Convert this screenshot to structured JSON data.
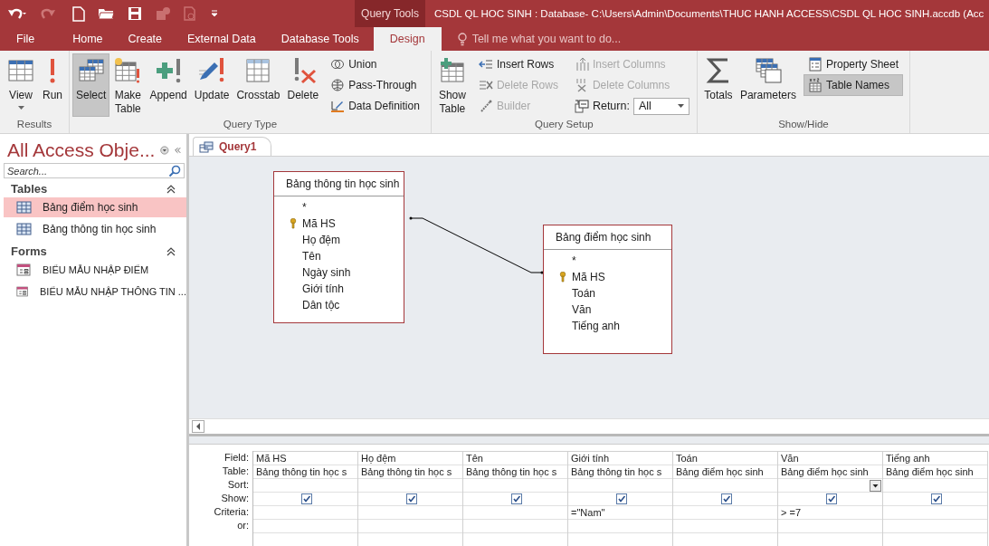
{
  "context_tab": "Query Tools",
  "window": {
    "title": "CSDL QL HOC SINH : Database- C:\\Users\\Admin\\Documents\\THUC HANH ACCESS\\CSDL QL HOC SINH.accdb (Acc"
  },
  "tabs": [
    {
      "label": "File",
      "selected": false
    },
    {
      "label": "Home",
      "selected": false
    },
    {
      "label": "Create",
      "selected": false
    },
    {
      "label": "External Data",
      "selected": false
    },
    {
      "label": "Database Tools",
      "selected": false
    },
    {
      "label": "Design",
      "selected": true
    }
  ],
  "tell_me": {
    "placeholder": "Tell me what you want to do..."
  },
  "ribbon": {
    "groups": [
      {
        "label": "Results",
        "large": [
          {
            "label": "View",
            "selected": false,
            "disabled": false,
            "has_menu": true
          },
          {
            "label": "Run",
            "selected": false,
            "disabled": false
          }
        ]
      },
      {
        "label": "Query Type",
        "large": [
          {
            "label": "Select",
            "selected": true,
            "disabled": false
          },
          {
            "label": "Make Table",
            "selected": false,
            "disabled": false
          },
          {
            "label": "Append",
            "selected": false,
            "disabled": false
          },
          {
            "label": "Update",
            "selected": false,
            "disabled": false
          },
          {
            "label": "Crosstab",
            "selected": false,
            "disabled": false
          },
          {
            "label": "Delete",
            "selected": false,
            "disabled": false
          }
        ],
        "small_columns": [
          [
            {
              "kind": "small",
              "label": "Union",
              "selected": false,
              "disabled": false
            },
            {
              "kind": "small",
              "label": "Pass-Through",
              "selected": false,
              "disabled": false
            },
            {
              "kind": "small",
              "label": "Data Definition",
              "selected": false,
              "disabled": false
            }
          ]
        ]
      },
      {
        "label": "Query Setup",
        "large": [
          {
            "label": "Show Table",
            "selected": false,
            "disabled": false
          }
        ],
        "small_columns": [
          [
            {
              "kind": "small",
              "label": "Insert Rows",
              "selected": false,
              "disabled": false
            },
            {
              "kind": "small",
              "label": "Delete Rows",
              "selected": false,
              "disabled": true
            },
            {
              "kind": "small",
              "label": "Builder",
              "selected": false,
              "disabled": true
            }
          ],
          [
            {
              "kind": "small",
              "label": "Insert Columns",
              "selected": false,
              "disabled": true
            },
            {
              "kind": "small",
              "label": "Delete Columns",
              "selected": false,
              "disabled": true
            },
            {
              "kind": "dropdown",
              "label": "Return:",
              "value": "All",
              "disabled": false
            }
          ]
        ]
      },
      {
        "label": "Show/Hide",
        "large": [
          {
            "label": "Totals",
            "selected": false,
            "disabled": false
          },
          {
            "label": "Parameters",
            "selected": false,
            "disabled": false
          }
        ],
        "small_columns": [
          [
            {
              "kind": "small",
              "label": "Property Sheet",
              "selected": false,
              "disabled": false
            },
            {
              "kind": "small",
              "label": "Table Names",
              "selected": true,
              "disabled": false
            }
          ]
        ]
      }
    ]
  },
  "navigation": {
    "title": "All Access Obje...",
    "search": {
      "placeholder": "Search..."
    },
    "groups": [
      {
        "label": "Tables",
        "kind": "tables",
        "items": [
          {
            "label": "Bảng điểm học sinh",
            "selected": true
          },
          {
            "label": "Bảng thông tin học sinh",
            "selected": false
          }
        ]
      },
      {
        "label": "Forms",
        "kind": "forms",
        "items": [
          {
            "label": "BIỂU MẪU NHẬP ĐIỂM",
            "selected": false
          },
          {
            "label": "BIỂU MẪU NHẬP THÔNG TIN ...",
            "selected": false
          }
        ]
      }
    ]
  },
  "document_tabs": [
    {
      "label": "Query1",
      "selected": true
    }
  ],
  "tables": [
    {
      "title": "Bảng thông tin học sinh",
      "fields": [
        {
          "name": "*",
          "key": false
        },
        {
          "name": "Mã HS",
          "key": true
        },
        {
          "name": "Họ đệm",
          "key": false
        },
        {
          "name": "Tên",
          "key": false
        },
        {
          "name": "Ngày sinh",
          "key": false
        },
        {
          "name": "Giới tính",
          "key": false
        },
        {
          "name": "Dân tộc",
          "key": false
        }
      ]
    },
    {
      "title": "Bảng điểm học sinh",
      "fields": [
        {
          "name": "*",
          "key": false
        },
        {
          "name": "Mã HS",
          "key": true
        },
        {
          "name": "Toán",
          "key": false
        },
        {
          "name": "Văn",
          "key": false
        },
        {
          "name": "Tiếng anh",
          "key": false
        }
      ]
    }
  ],
  "design_grid": {
    "row_labels": [
      "Field:",
      "Table:",
      "Sort:",
      "Show:",
      "Criteria:",
      "or:"
    ],
    "columns": [
      {
        "field": "Mã HS",
        "table": "Bảng thông tin học s",
        "show": true,
        "selected": false
      },
      {
        "field": "Họ đệm",
        "table": "Bảng thông tin học s",
        "show": true,
        "selected": false
      },
      {
        "field": "Tên",
        "table": "Bảng thông tin học s",
        "show": true,
        "selected": false
      },
      {
        "field": "Giới tính",
        "table": "Bảng thông tin học s",
        "show": true,
        "criteria": "=\"Nam\"",
        "selected": false
      },
      {
        "field": "Toán",
        "table": "Bảng điểm học sinh",
        "show": true,
        "selected": false
      },
      {
        "field": "Văn",
        "table": "Bảng điểm học sinh",
        "show": true,
        "criteria": "> =7",
        "selected": true
      },
      {
        "field": "Tiếng anh",
        "table": "Bảng điểm học sinh",
        "show": true,
        "selected": false
      }
    ]
  }
}
